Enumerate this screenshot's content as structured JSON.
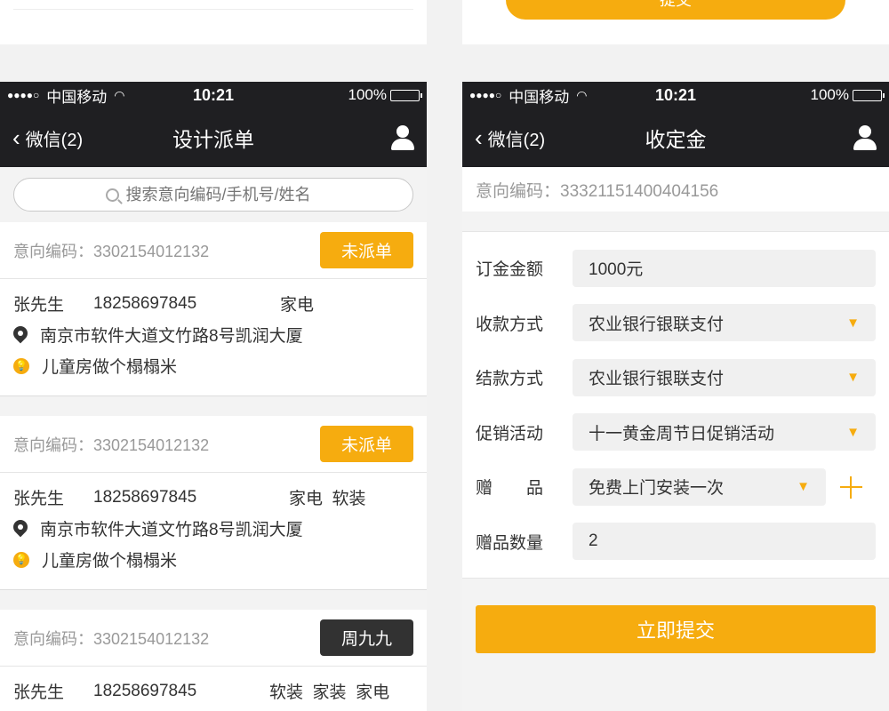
{
  "status": {
    "carrier": "中国移动",
    "time": "10:21",
    "battery": "100%"
  },
  "left": {
    "back_label": "微信(2)",
    "title": "设计派单",
    "search_placeholder": "搜索意向编码/手机号/姓名",
    "cards": [
      {
        "code": "意向编码：3302154012132",
        "badge": "未派单",
        "badge_color": "#f6ac0f",
        "name": "张先生",
        "phone": "18258697845",
        "tags": "家电",
        "address": "南京市软件大道文竹路8号凯润大厦",
        "note": "儿童房做个榻榻米"
      },
      {
        "code": "意向编码：3302154012132",
        "badge": "未派单",
        "badge_color": "#f6ac0f",
        "name": "张先生",
        "phone": "18258697845",
        "tags": "家电  软装",
        "address": "南京市软件大道文竹路8号凯润大厦",
        "note": "儿童房做个榻榻米"
      },
      {
        "code": "意向编码：3302154012132",
        "badge": "周九九",
        "badge_color": "#323232",
        "name": "张先生",
        "phone": "18258697845",
        "tags": "软装  家装  家电"
      }
    ]
  },
  "right": {
    "back_label": "微信(2)",
    "title": "收定金",
    "code": "意向编码：33321151400404156",
    "fields": {
      "deposit_label": "订金金额",
      "deposit_value": "1000元",
      "payment_label": "收款方式",
      "payment_value": "农业银行银联支付",
      "settle_label": "结款方式",
      "settle_value": "农业银行银联支付",
      "promo_label": "促销活动",
      "promo_value": "十一黄金周节日促销活动",
      "gift_label": "赠　　品",
      "gift_value": "免费上门安装一次",
      "gift_qty_label": "赠品数量",
      "gift_qty_value": "2"
    },
    "submit_label": "立即提交",
    "top_button_label": "提交"
  },
  "colors": {
    "accent": "#f6ac0f",
    "nav_bg": "#1f1f22"
  }
}
